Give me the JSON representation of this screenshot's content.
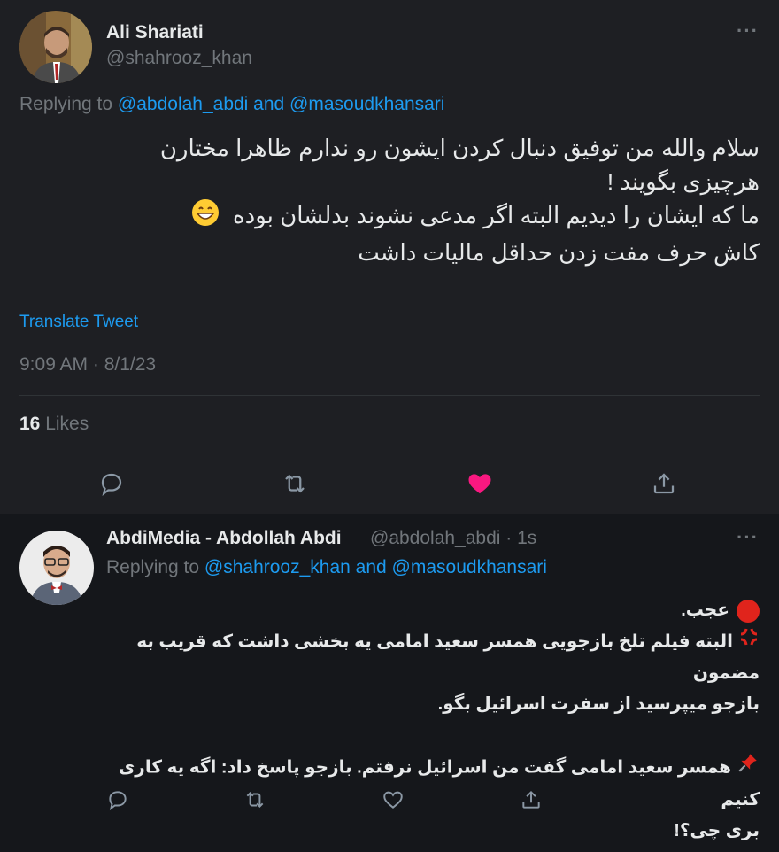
{
  "main_tweet": {
    "author_name": "Ali Shariati",
    "author_handle": "@shahrooz_khan",
    "replying_prefix": "Replying to",
    "replying_mentions": "@abdolah_abdi and @masoudkhansari",
    "lines": [
      "سلام والله من توفیق دنبال کردن ایشون رو ندارم  ظاهرا مختارن",
      "هرچیزی بگویند !",
      "ما که ایشان را دیدیم البته اگر مدعی نشوند بدلشان بوده",
      "کاش حرف مفت زدن  حداقل مالیات داشت"
    ],
    "translate_label": "Translate Tweet",
    "timestamp": "9:09 AM · 8/1/23",
    "likes_count": "16",
    "likes_label": "Likes"
  },
  "reply_tweet": {
    "author_name": "AbdiMedia - Abdollah Abdi",
    "author_handle": "@abdolah_abdi · 1s",
    "replying_prefix": "Replying to",
    "replying_mentions": "@shahrooz_khan and @masoudkhansari",
    "lines": [
      "عجب.",
      "البته فیلم تلخ بازجویی همسر سعید امامی یه بخشی داشت که قریب به مضمون",
      "بازجو میپرسید از سفرت اسرائیل بگو.",
      "همسر سعید امامی گفت من اسرائیل نرفتم. بازجو پاسخ داد: اگه یه کاری کنیم",
      "بری چی؟!"
    ]
  },
  "icons": {
    "more": "more-icon",
    "reply": "reply-icon",
    "retweet": "retweet-icon",
    "like": "heart-icon",
    "share": "share-icon"
  },
  "colors": {
    "background_main": "#1e1f23",
    "background_reply": "#15171b",
    "accent": "#1d9bf0",
    "like_active": "#f91880",
    "muted": "#71767b"
  }
}
